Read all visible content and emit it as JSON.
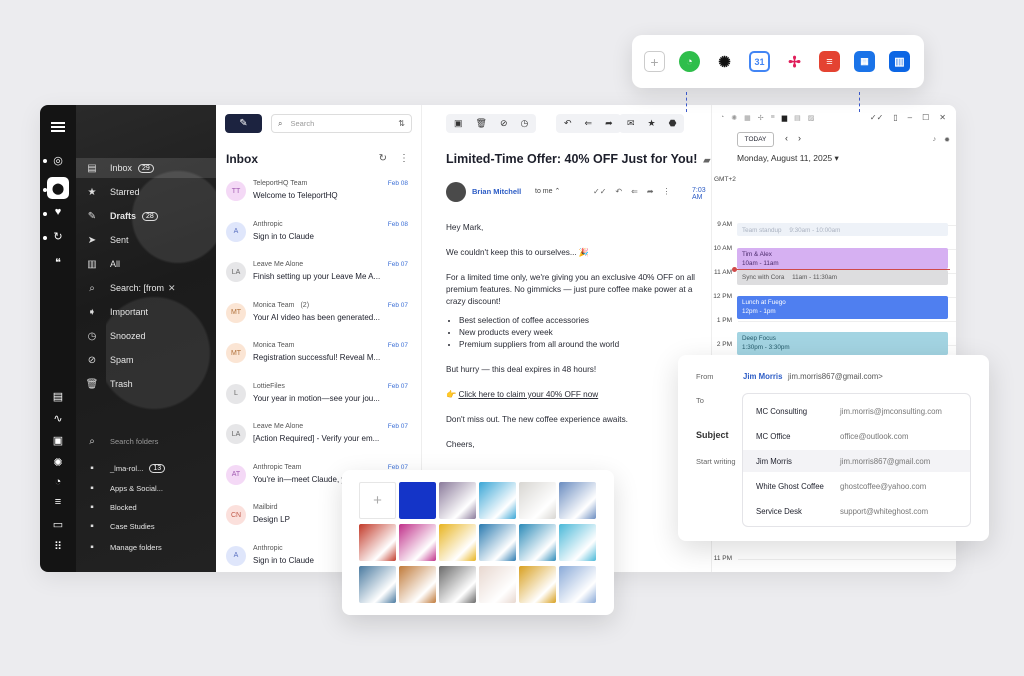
{
  "folders": {
    "items": [
      {
        "label": "Inbox",
        "count": "29",
        "icon": "inbox-icon",
        "glyph": "▤"
      },
      {
        "label": "Starred",
        "icon": "star-icon",
        "glyph": "★"
      },
      {
        "label": "Drafts",
        "count": "28",
        "icon": "drafts-icon",
        "glyph": "✎"
      },
      {
        "label": "Sent",
        "icon": "send-icon",
        "glyph": "➤"
      },
      {
        "label": "All",
        "icon": "all-mail-icon",
        "glyph": "▥"
      },
      {
        "label": "Search: [from",
        "icon": "search-icon",
        "glyph": "⌕"
      },
      {
        "label": "Important",
        "icon": "important-icon",
        "glyph": "➧"
      },
      {
        "label": "Snoozed",
        "icon": "clock-icon",
        "glyph": "◷"
      },
      {
        "label": "Spam",
        "icon": "spam-icon",
        "glyph": "⊘"
      },
      {
        "label": "Trash",
        "icon": "trash-icon",
        "glyph": "🗑"
      }
    ],
    "search_placeholder": "Search folders",
    "sub": [
      {
        "label": "_lma-rol...",
        "count": "13"
      },
      {
        "label": "Apps & Social..."
      },
      {
        "label": "Blocked"
      },
      {
        "label": "Case Studies"
      },
      {
        "label": "Manage folders"
      }
    ]
  },
  "list": {
    "search_placeholder": "Search",
    "title": "Inbox",
    "messages": [
      {
        "initials": "TT",
        "from": "TeleportHQ Team",
        "subject": "Welcome to TeleportHQ",
        "date": "Feb 08",
        "color": "#f4d9f6",
        "fg": "#a05ab0"
      },
      {
        "initials": "A",
        "from": "Anthropic",
        "subject": "Sign in to Claude",
        "date": "Feb 08",
        "color": "#dfe6fb",
        "fg": "#5a70c0"
      },
      {
        "initials": "LA",
        "from": "Leave Me Alone",
        "subject": "Finish setting up your Leave Me A...",
        "date": "Feb 07",
        "color": "#e6e6e8",
        "fg": "#666"
      },
      {
        "initials": "MT",
        "from": "Monica Team",
        "count": "(2)",
        "subject": "Your AI video has been generated...",
        "date": "Feb 07",
        "color": "#fbe5d4",
        "fg": "#b0703a"
      },
      {
        "initials": "MT",
        "from": "Monica Team",
        "subject": "Registration successful! Reveal M...",
        "date": "Feb 07",
        "color": "#fbe5d4",
        "fg": "#b0703a"
      },
      {
        "initials": "L",
        "from": "LottieFiles",
        "subject": "Your year in motion—see your jou...",
        "date": "Feb 07",
        "color": "#e6e6e8",
        "fg": "#666"
      },
      {
        "initials": "LA",
        "from": "Leave Me Alone",
        "subject": "[Action Required] - Verify your em...",
        "date": "Feb 07",
        "color": "#e6e6e8",
        "fg": "#666"
      },
      {
        "initials": "AT",
        "from": "Anthropic Team",
        "subject": "You're in—meet Claude, your new...",
        "date": "Feb 07",
        "color": "#f4d9f6",
        "fg": "#a05ab0"
      },
      {
        "initials": "CN",
        "from": "Mailbird",
        "subject": "Design LP",
        "date": "",
        "color": "#fbe0dc",
        "fg": "#c05a4a"
      },
      {
        "initials": "A",
        "from": "Anthropic",
        "subject": "Sign in to Claude",
        "date": "",
        "color": "#dfe6fb",
        "fg": "#5a70c0"
      }
    ]
  },
  "email": {
    "subject": "Limited-Time Offer: 40% OFF Just for You!",
    "sender": "Brian Mitchell",
    "to": "to me",
    "time": "7:03 AM",
    "greeting": "Hey Mark,",
    "p1": "We couldn't keep this to ourselves... 🎉",
    "p2": "For a limited time only, we're giving you an exclusive 40% OFF on all premium features. No gimmicks — just pure coffee make power at a crazy discount!",
    "bullets": [
      "Best selection of coffee accessories",
      "New products every week",
      "Premium suppliers from all around the world"
    ],
    "p3": "But hurry — this deal expires in 48 hours!",
    "cta_emoji": "👉",
    "cta": "Click here to claim your 40% OFF now",
    "p4": "Don't miss out. The new coffee experience awaits.",
    "closing": "Cheers,"
  },
  "calendar": {
    "today_label": "TODAY",
    "date": "Monday, August 11, 2025",
    "timezone": "GMT+2",
    "hours": [
      "9 AM",
      "10 AM",
      "11 AM",
      "12 PM",
      "1 PM",
      "2 PM",
      "11 PM"
    ],
    "events": [
      {
        "title": "Team standup",
        "time": "9:30am - 10:00am"
      },
      {
        "title": "Tim & Alex",
        "time": "10am - 11am"
      },
      {
        "title": "Sync with Cora",
        "time": "11am - 11:30am"
      },
      {
        "title": "Lunch at Fuego",
        "time": "12pm - 1pm"
      },
      {
        "title": "Deep Focus",
        "time": "1:30pm - 3:30pm"
      }
    ]
  },
  "apps": [
    "WhatsApp",
    "ChatGPT",
    "Google Calendar",
    "Slack",
    "Todoist",
    "Calendar",
    "Trello"
  ],
  "contacts": {
    "from_label": "From",
    "from_name": "Jim Morris",
    "from_email": "jim.morris867@gmail.com>",
    "to_label": "To",
    "subject_label": "Subject",
    "start_writing": "Start writing",
    "options": [
      {
        "name": "MC Consulting",
        "email": "jim.morris@jmconsulting.com"
      },
      {
        "name": "MC Office",
        "email": "office@outlook.com"
      },
      {
        "name": "Jim Morris",
        "email": "jim.morris867@gmail.com"
      },
      {
        "name": "White Ghost Coffee",
        "email": "ghostcoffee@yahoo.com"
      },
      {
        "name": "Service Desk",
        "email": "support@whiteghost.com"
      }
    ]
  },
  "picker": {
    "thumb_colors": [
      "#1434c8",
      "#8a7a9a",
      "#3aa6d6",
      "#d8d6d2",
      "#6a8cc0",
      "#c23a2a",
      "#c0308a",
      "#e8b420",
      "#2a7ab0",
      "#2b8ab8",
      "#4ab8d8",
      "#4a7aa0",
      "#c07a3a",
      "#6a6a6a",
      "#e8d8d0",
      "#d8a020",
      "#8aaad8"
    ]
  }
}
